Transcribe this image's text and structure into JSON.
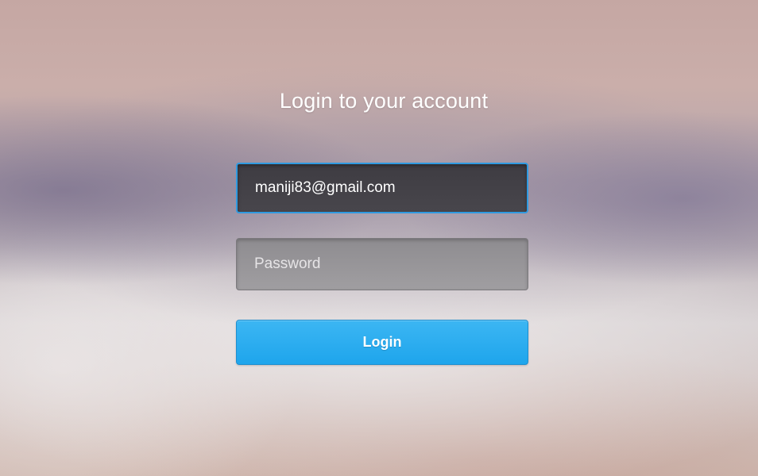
{
  "login": {
    "title": "Login to your account",
    "email": {
      "value": "maniji83@gmail.com"
    },
    "password": {
      "value": "",
      "placeholder": "Password"
    },
    "submit_label": "Login"
  },
  "colors": {
    "accent": "#24a8ee",
    "focus_border": "#2f9ae0",
    "email_field_bg": "#423f45",
    "password_field_bg": "#969497"
  }
}
